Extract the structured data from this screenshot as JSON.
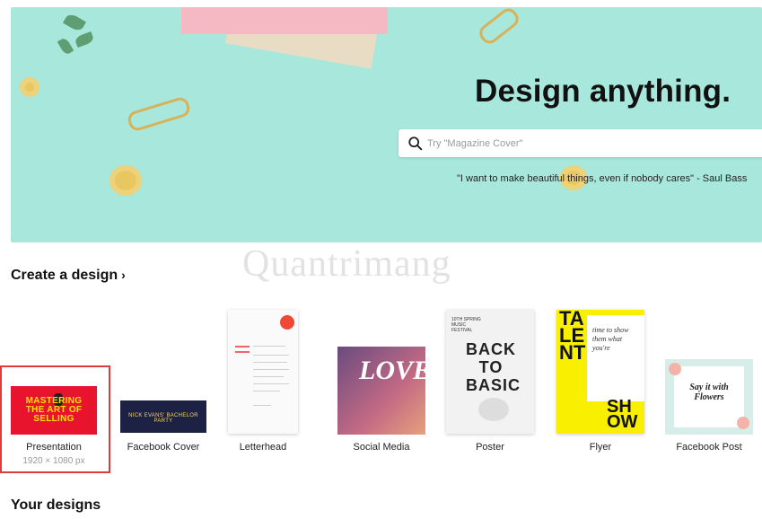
{
  "hero": {
    "title": "Design anything.",
    "search_placeholder": "Try \"Magazine Cover\"",
    "quote": "\"I want to make beautiful things, even if nobody cares\" - Saul Bass",
    "background_color": "#a8e8dc"
  },
  "create_section": {
    "title": "Create a design",
    "chevron": "›"
  },
  "watermark": "Quantrimang",
  "designs": [
    {
      "label": "Presentation",
      "sub": "1920 × 1080 px",
      "preview_text": "MASTERING THE ART OF SELLING",
      "selected": true
    },
    {
      "label": "Facebook Cover",
      "preview_text": "NICK EVANS' BACHELOR PARTY"
    },
    {
      "label": "Letterhead"
    },
    {
      "label": "Social Media",
      "preview_text": "LOVE"
    },
    {
      "label": "Poster",
      "preview_text": "BACK TO BASIC",
      "preview_small": "10TH SPRING MUSIC FESTIVAL"
    },
    {
      "label": "Flyer",
      "preview_text": "TALENT",
      "preview_script": "time to show them what you're",
      "preview_bottom": "SHOW"
    },
    {
      "label": "Facebook Post",
      "preview_text": "Say it with Flowers"
    }
  ],
  "your_designs": {
    "title": "Your designs"
  },
  "colors": {
    "selected_border": "#e03a3a",
    "presentation_bg": "#e8142d",
    "flyer_bg": "#f8f000"
  }
}
